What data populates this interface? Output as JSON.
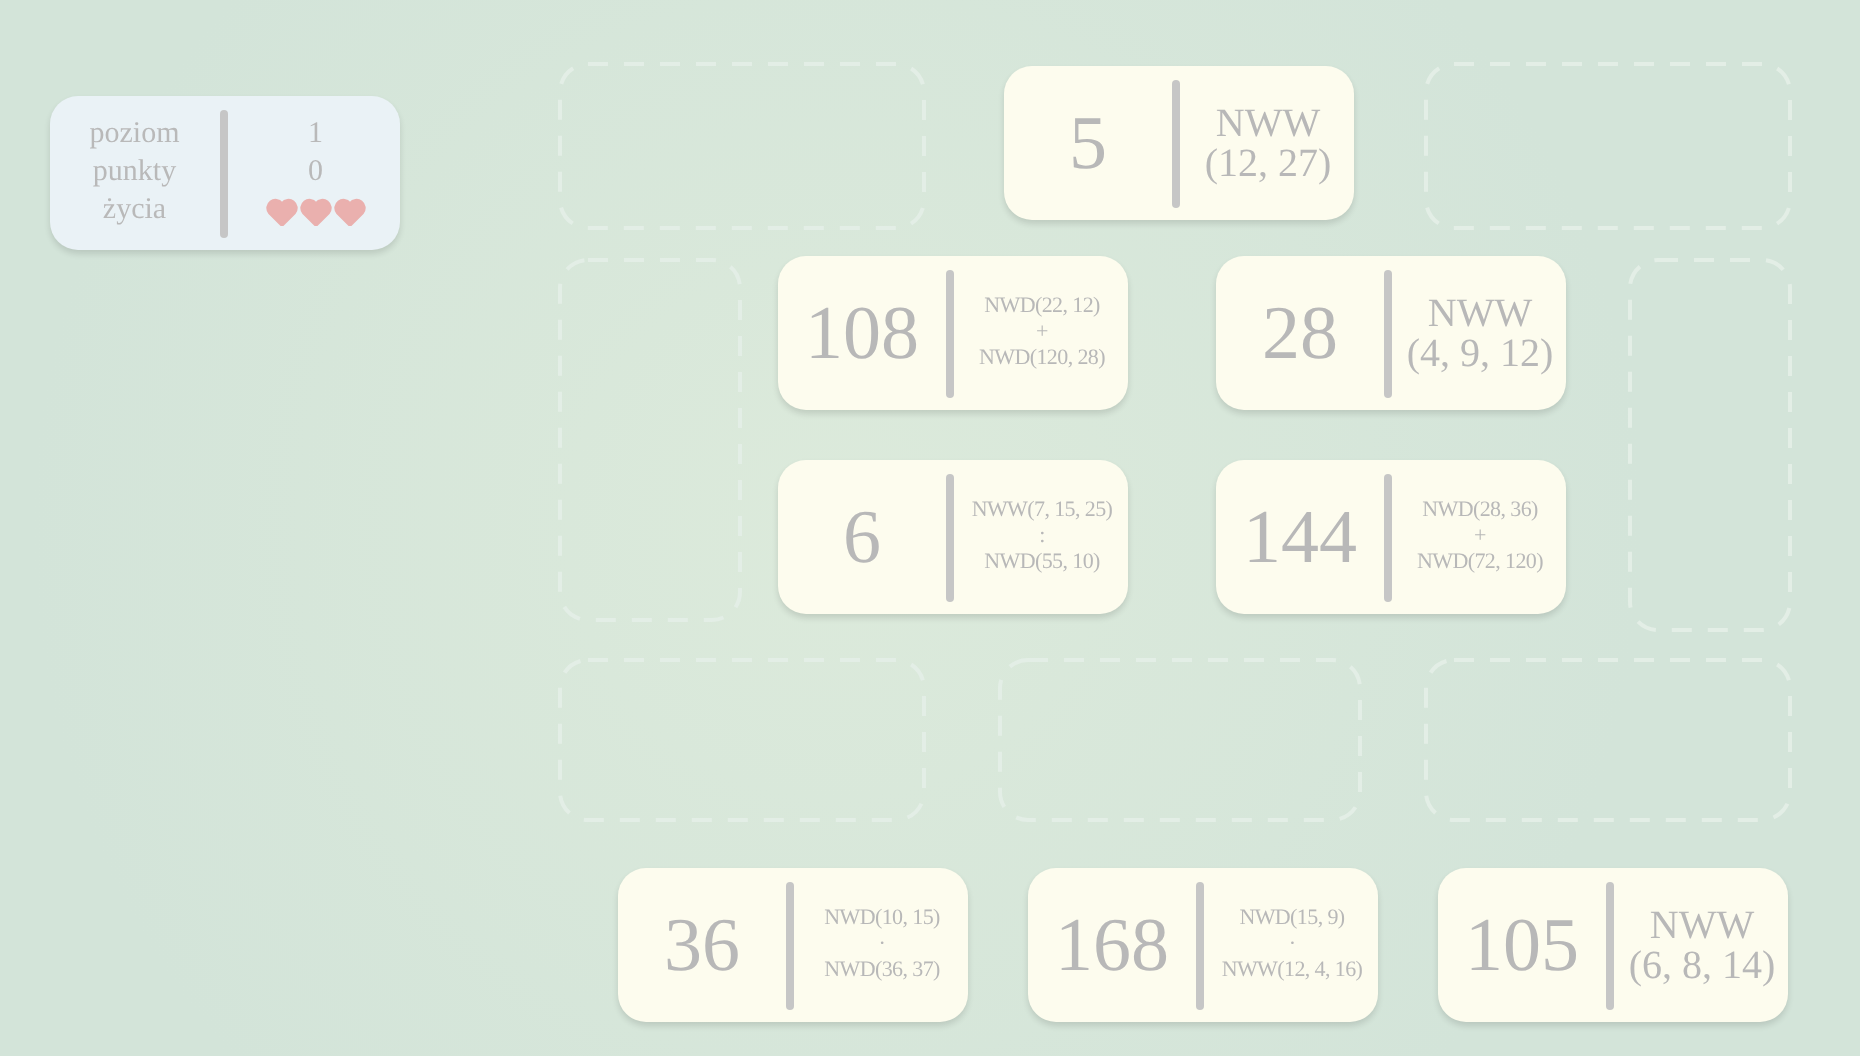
{
  "status": {
    "rows": [
      {
        "label": "poziom",
        "value": "1"
      },
      {
        "label": "punkty",
        "value": "0"
      },
      {
        "label": "życia",
        "lives": [
          {
            "filled": true
          },
          {
            "filled": true
          },
          {
            "filled": true
          }
        ]
      }
    ]
  },
  "board_tiles": [
    {
      "value": "5",
      "kind": "simple",
      "expression": [
        "NWW",
        "(12, 27)"
      ]
    },
    {
      "value": "108",
      "kind": "compound",
      "expression": [
        "NWD(22, 12)",
        "+",
        "NWD(120, 28)"
      ]
    },
    {
      "value": "28",
      "kind": "simple",
      "expression": [
        "NWW",
        "(4, 9, 12)"
      ]
    },
    {
      "value": "6",
      "kind": "compound",
      "expression": [
        "NWW(7, 15, 25)",
        ":",
        "NWD(55, 10)"
      ]
    },
    {
      "value": "144",
      "kind": "compound",
      "expression": [
        "NWD(28, 36)",
        "+",
        "NWD(72, 120)"
      ]
    }
  ],
  "hand_tiles": [
    {
      "value": "36",
      "kind": "compound",
      "expression": [
        "NWD(10, 15)",
        "·",
        "NWD(36, 37)"
      ]
    },
    {
      "value": "168",
      "kind": "compound",
      "expression": [
        "NWD(15, 9)",
        "·",
        "NWW(12, 4, 16)"
      ]
    },
    {
      "value": "105",
      "kind": "simple",
      "expression": [
        "NWW",
        "(6, 8, 14)"
      ]
    }
  ]
}
